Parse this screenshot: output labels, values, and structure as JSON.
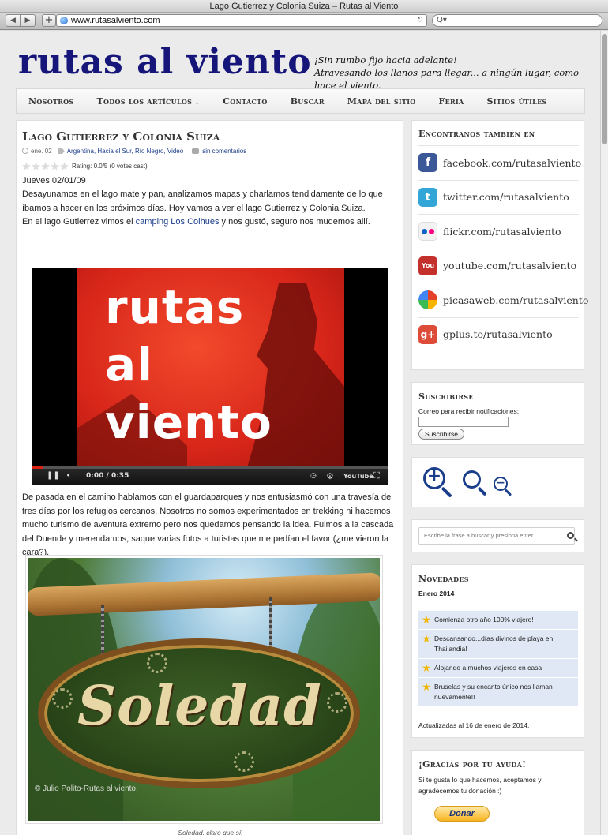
{
  "browser": {
    "window_title": "Lago Gutierrez y Colonia Suiza – Rutas al Viento",
    "url": "www.rutasalviento.com",
    "back_icon": "◀",
    "forward_icon": "▶",
    "add_icon": "+",
    "reload_icon": "↻",
    "search_icon": "Q▾"
  },
  "site": {
    "title": "rutas al viento",
    "tagline_line1": "¡Sin rumbo fijo hacia adelante!",
    "tagline_line2": "Atravesando los llanos para llegar...  a ningún lugar, como hace el viento."
  },
  "menu": {
    "items": [
      {
        "label": "Nosotros"
      },
      {
        "label": "Todos los artículos"
      },
      {
        "label": "Contacto"
      },
      {
        "label": "Buscar"
      },
      {
        "label": "Mapa del sitio"
      },
      {
        "label": "Feria"
      },
      {
        "label": "Sitios útiles"
      }
    ],
    "chevron": "⌄"
  },
  "post": {
    "title": "Lago Gutierrez y Colonia Suiza",
    "date": "ene. 02",
    "categories": "Argentina, Hacia el Sur, Río Negro, Video",
    "comments": "sin comentarios",
    "rating_text": "Rating: 0.0/5 (0 votes cast)",
    "rating_value": 0,
    "rating_max": 5,
    "day_line": "Jueves 02/01/09",
    "para1": "Desayunamos en el lago mate y pan, analizamos mapas y charlamos tendidamente de lo que íbamos a hacer en los próximos días. Hoy vamos a ver el lago Gutierrez y Colonia Suiza.",
    "para2_before": "En el lago Gutierrez vimos el ",
    "para2_link": "camping Los Coihues",
    "para2_after": " y nos gustó, seguro nos mudemos allí.",
    "video": {
      "text_line1": "rutas",
      "text_line2": "al",
      "text_line3": "viento",
      "time": "0:00 / 0:35",
      "progress": 0.03,
      "logo": "YouTube"
    },
    "para3": "De pasada en el camino hablamos con el guardaparques y nos entusiasmó con una travesía de tres días por los refugios cercanos. Nosotros no somos experimentados en trekking ni hacemos mucho turismo de aventura extremo pero nos quedamos pensando la idea. Fuimos a la cascada del Duende y merendamos, saque varias fotos a turistas que me pedían el favor (¿me vieron la cara?).",
    "photo": {
      "sign_text": "Soledad",
      "watermark": "© Julio Polito-Rutas al viento."
    },
    "caption": "Soledad, claro que sí."
  },
  "sidebar": {
    "social": {
      "title": "Encontranos también en",
      "items": [
        {
          "label": "facebook.com/rutasalviento",
          "icon": "f",
          "color": "#3b5998"
        },
        {
          "label": "twitter.com/rutasalviento",
          "icon": "t",
          "color": "#33a6d8"
        },
        {
          "label": "flickr.com/rutasalviento",
          "icon": "",
          "color": "#ffffff"
        },
        {
          "label": "youtube.com/rutasalviento",
          "icon": "You",
          "color": "#c4302b"
        },
        {
          "label": "picasaweb.com/rutasalviento",
          "icon": "",
          "color": "#ffffff"
        },
        {
          "label": "gplus.to/rutasalviento",
          "icon": "g+",
          "color": "#dd4b39"
        }
      ]
    },
    "subscribe": {
      "title": "Suscribirse",
      "label": "Correo para recibir notificaciones:",
      "button": "Suscribirse"
    },
    "zoom": {
      "plus": "+",
      "minus": "−"
    },
    "search": {
      "placeholder": "Escribe la frase a buscar y presiona enter"
    },
    "novedades": {
      "title": "Novedades",
      "subtitle": "Enero 2014",
      "items": [
        {
          "label": "Comienza otro año 100% viajero!"
        },
        {
          "label": "Descansando...días divinos de playa en Thailandia!"
        },
        {
          "label": "Alojando a muchos viajeros en casa"
        },
        {
          "label": "Bruselas y su encanto único nos llaman nuevamente!!"
        }
      ],
      "updated": "Actualizadas al 16 de enero de 2014."
    },
    "donate": {
      "title": "¡Gracias por tu ayuda!",
      "text": "Si te gusta lo que hacemos, aceptamos y agradecemos tu donación :)",
      "button": "Donar"
    }
  }
}
